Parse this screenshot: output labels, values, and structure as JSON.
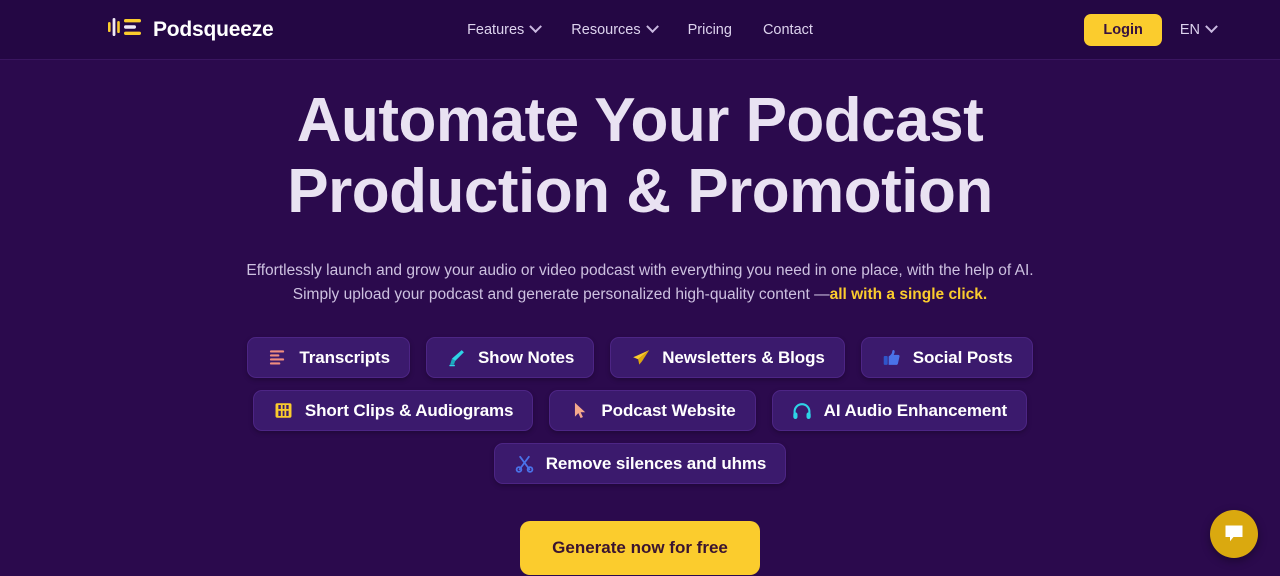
{
  "header": {
    "brand": {
      "name": "Podsqueeze",
      "icon": "podsqueeze-waveform-logo"
    },
    "nav": [
      {
        "label": "Features",
        "has_dropdown": true
      },
      {
        "label": "Resources",
        "has_dropdown": true
      },
      {
        "label": "Pricing",
        "has_dropdown": false
      },
      {
        "label": "Contact",
        "has_dropdown": false
      }
    ],
    "login_label": "Login",
    "language": "EN"
  },
  "hero": {
    "title_line1": "Automate Your Podcast",
    "title_line2": "Production & Promotion",
    "subtitle_line1": "Effortlessly launch and grow your audio or video podcast with everything you need in one place, with the help of AI.",
    "subtitle_line2_plain": "Simply upload your podcast and generate personalized high-quality content —",
    "subtitle_line2_accent": "all with a single click.",
    "cta_label": "Generate now for free"
  },
  "features": {
    "row1": [
      {
        "label": "Transcripts",
        "icon": "transcript-lines-icon",
        "color": "#f08d7e"
      },
      {
        "label": "Show Notes",
        "icon": "highlighter-pen-icon",
        "color": "#2ed4e6"
      },
      {
        "label": "Newsletters & Blogs",
        "icon": "paper-plane-icon",
        "color": "#fbcc2d"
      },
      {
        "label": "Social Posts",
        "icon": "thumbs-up-icon",
        "color": "#4a72e8"
      }
    ],
    "row2": [
      {
        "label": "Short Clips & Audiograms",
        "icon": "film-strip-icon",
        "color": "#fbcc2d"
      },
      {
        "label": "Podcast Website",
        "icon": "cursor-arrow-icon",
        "color": "#f5a98c"
      },
      {
        "label": "AI Audio Enhancement",
        "icon": "headphones-icon",
        "color": "#2ed4e6"
      }
    ],
    "row3": [
      {
        "label": "Remove silences and uhms",
        "icon": "scissors-icon",
        "color": "#4a72e8"
      }
    ]
  },
  "chat_widget": {
    "icon": "chat-bubble-icon",
    "color": "#daa90f"
  },
  "colors": {
    "page_bg": "#2b0a4d",
    "header_bg": "#240744",
    "pill_bg": "#3b1a6d",
    "accent_yellow": "#fbcc2d",
    "heading": "#e9e2f2"
  }
}
